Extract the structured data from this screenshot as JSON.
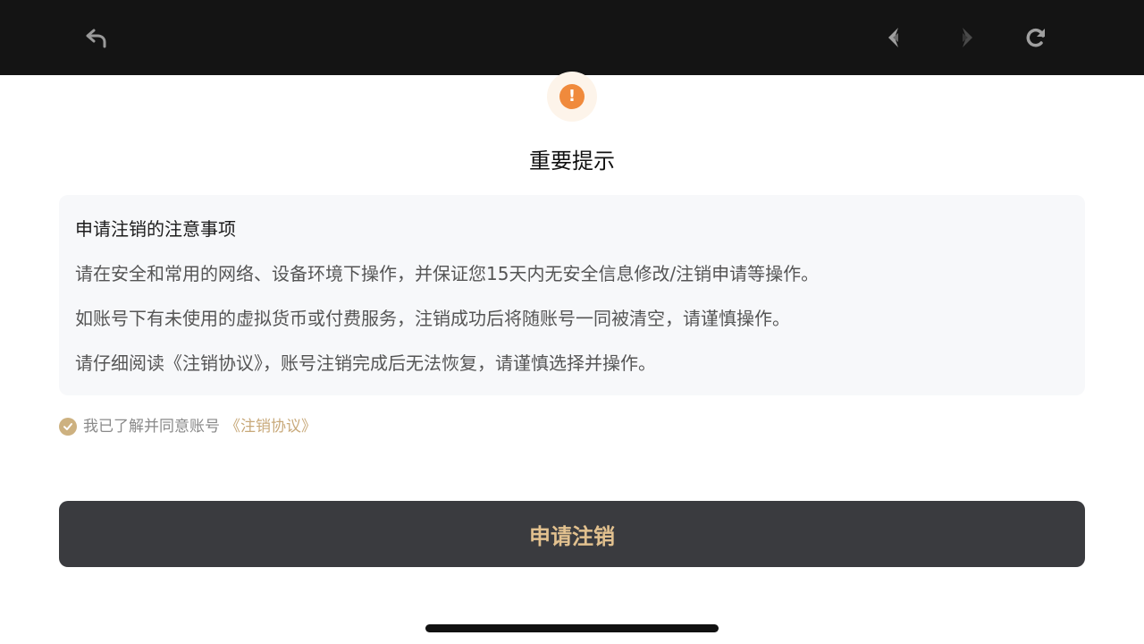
{
  "topbar": {
    "back_icon": "undo-arrow-icon",
    "prev_icon": "arrow-left-icon",
    "next_icon": "arrow-right-icon",
    "reload_icon": "refresh-icon",
    "next_disabled": true
  },
  "warning": {
    "icon": "exclamation-icon",
    "symbol": "!",
    "color": "#f08a3c"
  },
  "page": {
    "title": "重要提示"
  },
  "notice": {
    "heading": "申请注销的注意事项",
    "lines": [
      "请在安全和常用的网络、设备环境下操作，并保证您15天内无安全信息修改/注销申请等操作。",
      "如账号下有未使用的虚拟货币或付费服务，注销成功后将随账号一同被清空，请谨慎操作。",
      "请仔细阅读《注销协议》，账号注销完成后无法恢复，请谨慎选择并操作。"
    ]
  },
  "agreement": {
    "checked": true,
    "text": "我已了解并同意账号",
    "link": "《注销协议》"
  },
  "action": {
    "button_label": "申请注销"
  },
  "colors": {
    "topbar": "#141414",
    "accent_gold": "#e2c18f",
    "button_bg": "#3a3b3f",
    "link": "#c8a97a"
  }
}
